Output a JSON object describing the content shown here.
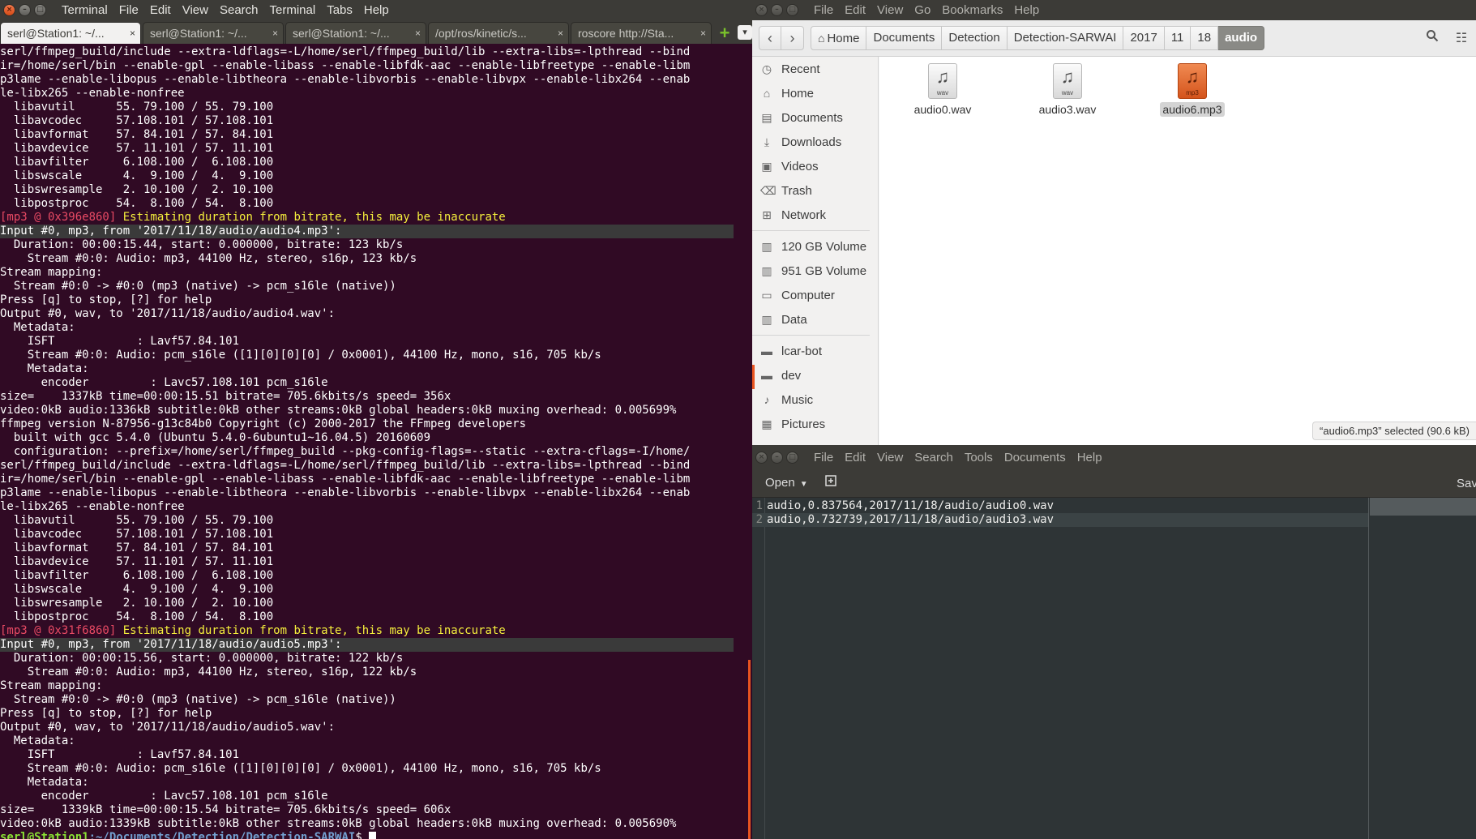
{
  "terminal": {
    "menu": [
      "Terminal",
      "File",
      "Edit",
      "View",
      "Search",
      "Terminal",
      "Tabs",
      "Help"
    ],
    "tabs": [
      {
        "label": "serl@Station1: ~/...",
        "active": true
      },
      {
        "label": "serl@Station1: ~/...",
        "active": false
      },
      {
        "label": "serl@Station1: ~/...",
        "active": false
      },
      {
        "label": "/opt/ros/kinetic/s...",
        "active": false
      },
      {
        "label": "roscore http://Sta...",
        "active": false
      }
    ],
    "lines": [
      {
        "text": "serl/ffmpeg_build/include --extra-ldflags=-L/home/serl/ffmpeg_build/lib --extra-libs=-lpthread --bind"
      },
      {
        "text": "ir=/home/serl/bin --enable-gpl --enable-libass --enable-libfdk-aac --enable-libfreetype --enable-libm"
      },
      {
        "text": "p3lame --enable-libopus --enable-libtheora --enable-libvorbis --enable-libvpx --enable-libx264 --enab"
      },
      {
        "text": "le-libx265 --enable-nonfree"
      },
      {
        "text": "  libavutil      55. 79.100 / 55. 79.100"
      },
      {
        "text": "  libavcodec     57.108.101 / 57.108.101"
      },
      {
        "text": "  libavformat    57. 84.101 / 57. 84.101"
      },
      {
        "text": "  libavdevice    57. 11.101 / 57. 11.101"
      },
      {
        "text": "  libavfilter     6.108.100 /  6.108.100"
      },
      {
        "text": "  libswscale      4.  9.100 /  4.  9.100"
      },
      {
        "text": "  libswresample   2. 10.100 /  2. 10.100"
      },
      {
        "text": "  libpostproc    54.  8.100 / 54.  8.100"
      },
      {
        "type": "warn",
        "tag": "[mp3 @ 0x396e860]",
        "text": " Estimating duration from bitrate, this may be inaccurate"
      },
      {
        "type": "hl",
        "text": "Input #0, mp3, from '2017/11/18/audio/audio4.mp3':"
      },
      {
        "text": "  Duration: 00:00:15.44, start: 0.000000, bitrate: 123 kb/s"
      },
      {
        "text": "    Stream #0:0: Audio: mp3, 44100 Hz, stereo, s16p, 123 kb/s"
      },
      {
        "text": "Stream mapping:"
      },
      {
        "text": "  Stream #0:0 -> #0:0 (mp3 (native) -> pcm_s16le (native))"
      },
      {
        "text": "Press [q] to stop, [?] for help"
      },
      {
        "text": "Output #0, wav, to '2017/11/18/audio/audio4.wav':"
      },
      {
        "text": "  Metadata:"
      },
      {
        "text": "    ISFT            : Lavf57.84.101"
      },
      {
        "text": "    Stream #0:0: Audio: pcm_s16le ([1][0][0][0] / 0x0001), 44100 Hz, mono, s16, 705 kb/s"
      },
      {
        "text": "    Metadata:"
      },
      {
        "text": "      encoder         : Lavc57.108.101 pcm_s16le"
      },
      {
        "text": "size=    1337kB time=00:00:15.51 bitrate= 705.6kbits/s speed= 356x"
      },
      {
        "text": "video:0kB audio:1336kB subtitle:0kB other streams:0kB global headers:0kB muxing overhead: 0.005699%"
      },
      {
        "text": "ffmpeg version N-87956-g13c84b0 Copyright (c) 2000-2017 the FFmpeg developers"
      },
      {
        "text": "  built with gcc 5.4.0 (Ubuntu 5.4.0-6ubuntu1~16.04.5) 20160609"
      },
      {
        "text": "  configuration: --prefix=/home/serl/ffmpeg_build --pkg-config-flags=--static --extra-cflags=-I/home/"
      },
      {
        "text": "serl/ffmpeg_build/include --extra-ldflags=-L/home/serl/ffmpeg_build/lib --extra-libs=-lpthread --bind"
      },
      {
        "text": "ir=/home/serl/bin --enable-gpl --enable-libass --enable-libfdk-aac --enable-libfreetype --enable-libm"
      },
      {
        "text": "p3lame --enable-libopus --enable-libtheora --enable-libvorbis --enable-libvpx --enable-libx264 --enab"
      },
      {
        "text": "le-libx265 --enable-nonfree"
      },
      {
        "text": "  libavutil      55. 79.100 / 55. 79.100"
      },
      {
        "text": "  libavcodec     57.108.101 / 57.108.101"
      },
      {
        "text": "  libavformat    57. 84.101 / 57. 84.101"
      },
      {
        "text": "  libavdevice    57. 11.101 / 57. 11.101"
      },
      {
        "text": "  libavfilter     6.108.100 /  6.108.100"
      },
      {
        "text": "  libswscale      4.  9.100 /  4.  9.100"
      },
      {
        "text": "  libswresample   2. 10.100 /  2. 10.100"
      },
      {
        "text": "  libpostproc    54.  8.100 / 54.  8.100"
      },
      {
        "type": "warn",
        "tag": "[mp3 @ 0x31f6860]",
        "text": " Estimating duration from bitrate, this may be inaccurate"
      },
      {
        "type": "hl",
        "text": "Input #0, mp3, from '2017/11/18/audio/audio5.mp3':"
      },
      {
        "text": "  Duration: 00:00:15.56, start: 0.000000, bitrate: 122 kb/s"
      },
      {
        "text": "    Stream #0:0: Audio: mp3, 44100 Hz, stereo, s16p, 122 kb/s"
      },
      {
        "text": "Stream mapping:"
      },
      {
        "text": "  Stream #0:0 -> #0:0 (mp3 (native) -> pcm_s16le (native))"
      },
      {
        "text": "Press [q] to stop, [?] for help"
      },
      {
        "text": "Output #0, wav, to '2017/11/18/audio/audio5.wav':"
      },
      {
        "text": "  Metadata:"
      },
      {
        "text": "    ISFT            : Lavf57.84.101"
      },
      {
        "text": "    Stream #0:0: Audio: pcm_s16le ([1][0][0][0] / 0x0001), 44100 Hz, mono, s16, 705 kb/s"
      },
      {
        "text": "    Metadata:"
      },
      {
        "text": "      encoder         : Lavc57.108.101 pcm_s16le"
      },
      {
        "text": "size=    1339kB time=00:00:15.54 bitrate= 705.6kbits/s speed= 606x"
      },
      {
        "text": "video:0kB audio:1339kB subtitle:0kB other streams:0kB global headers:0kB muxing overhead: 0.005690%"
      },
      {
        "type": "prompt",
        "user": "serl@Station1",
        "path": ":~/Documents/Detection/Detection-SARWAI",
        "text": "$ "
      }
    ]
  },
  "files": {
    "menu": [
      "File",
      "Edit",
      "View",
      "Go",
      "Bookmarks",
      "Help"
    ],
    "breadcrumbs": [
      "Home",
      "Documents",
      "Detection",
      "Detection-SARWAI",
      "2017",
      "11",
      "18",
      "audio"
    ],
    "sidebar": [
      {
        "label": "Recent",
        "icon": "clock-icon"
      },
      {
        "label": "Home",
        "icon": "home-icon"
      },
      {
        "label": "Documents",
        "icon": "documents-icon"
      },
      {
        "label": "Downloads",
        "icon": "download-icon"
      },
      {
        "label": "Videos",
        "icon": "video-icon"
      },
      {
        "label": "Trash",
        "icon": "trash-icon"
      },
      {
        "label": "Network",
        "icon": "network-icon"
      },
      {
        "sep": true
      },
      {
        "label": "120 GB Volume",
        "icon": "drive-icon"
      },
      {
        "label": "951 GB Volume",
        "icon": "drive-icon"
      },
      {
        "label": "Computer",
        "icon": "computer-icon"
      },
      {
        "label": "Data",
        "icon": "drive-icon"
      },
      {
        "sep": true
      },
      {
        "label": "lcar-bot",
        "icon": "folder-icon"
      },
      {
        "label": "dev",
        "icon": "folder-icon"
      },
      {
        "label": "Music",
        "icon": "music-icon"
      },
      {
        "label": "Pictures",
        "icon": "pictures-icon"
      }
    ],
    "items": [
      {
        "name": "audio0.wav",
        "ext": "wav",
        "selected": false
      },
      {
        "name": "audio3.wav",
        "ext": "wav",
        "selected": false
      },
      {
        "name": "audio6.mp3",
        "ext": "mp3",
        "selected": true
      }
    ],
    "status": "“audio6.mp3” selected  (90.6 kB)"
  },
  "gedit": {
    "menu": [
      "File",
      "Edit",
      "View",
      "Search",
      "Tools",
      "Documents",
      "Help"
    ],
    "open_label": "Open",
    "save_label": "Save",
    "lines": [
      {
        "num": "1",
        "text": "audio,0.837564,2017/11/18/audio/audio0.wav"
      },
      {
        "num": "2",
        "text": "audio,0.732739,2017/11/18/audio/audio3.wav"
      }
    ]
  }
}
